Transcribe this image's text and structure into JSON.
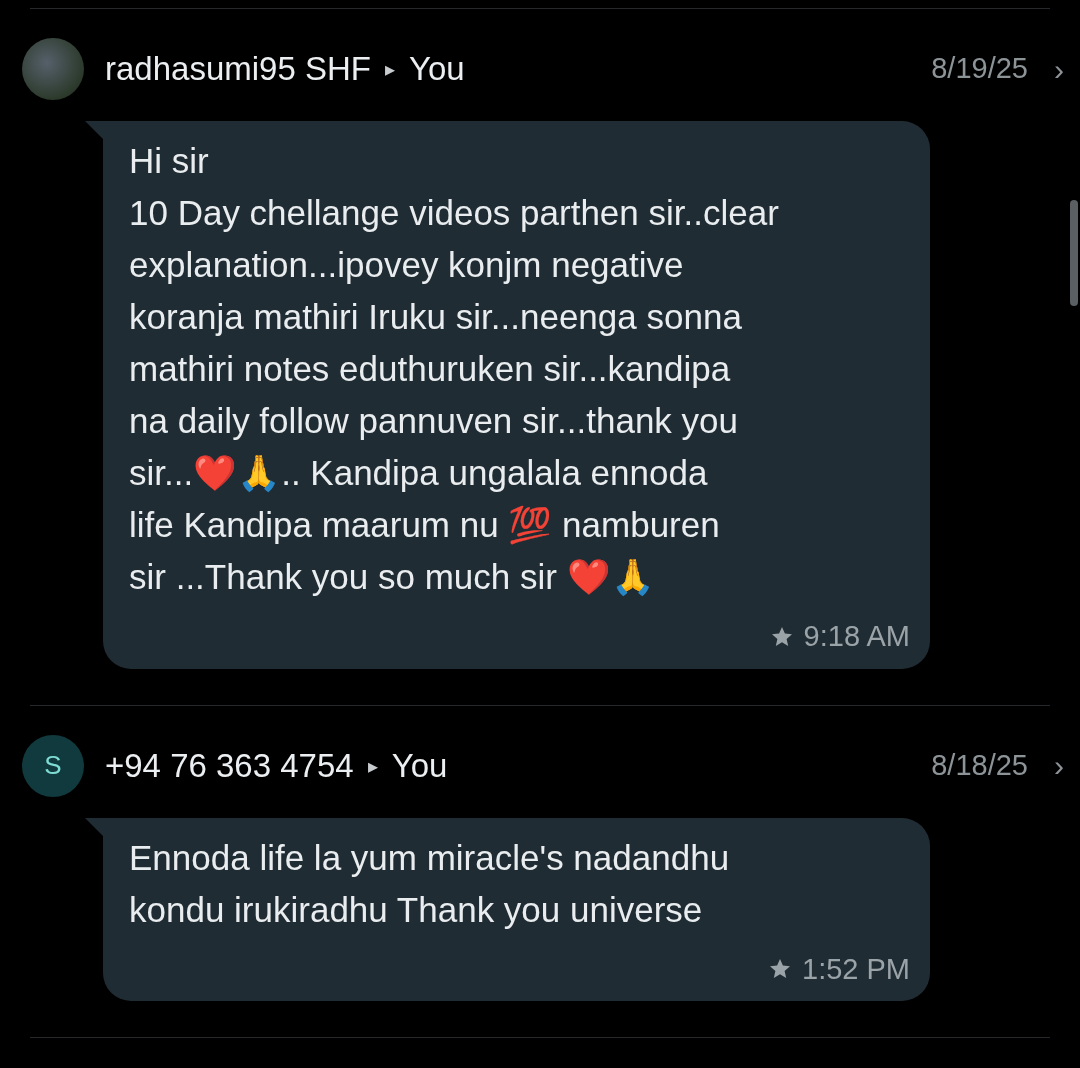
{
  "messages": [
    {
      "sender": "radhasumi95 SHF",
      "separator": "▸",
      "recipient": "You",
      "date": "8/19/25",
      "chevron": "›",
      "avatar": {
        "kind": "photo"
      },
      "text": "Hi sir\n10 Day chellange videos parthen sir..clear\nexplanation...ipovey konjm negative\nkoranja mathiri Iruku sir...neenga sonna\nmathiri notes eduthuruken sir...kandipa\nna daily follow pannuven sir...thank you\nsir...❤️🙏.. Kandipa ungalala ennoda\nlife Kandipa maarum nu 💯 namburen\nsir ...Thank you so much sir ❤️🙏",
      "starred": true,
      "time": "9:18 AM"
    },
    {
      "sender": "+94 76 363 4754",
      "separator": "▸",
      "recipient": "You",
      "date": "8/18/25",
      "chevron": "›",
      "avatar": {
        "kind": "initial",
        "letter": "S"
      },
      "text": "Ennoda life la yum miracle's nadandhu\nkondu irukiradhu Thank you universe",
      "starred": true,
      "time": "1:52 PM"
    }
  ]
}
